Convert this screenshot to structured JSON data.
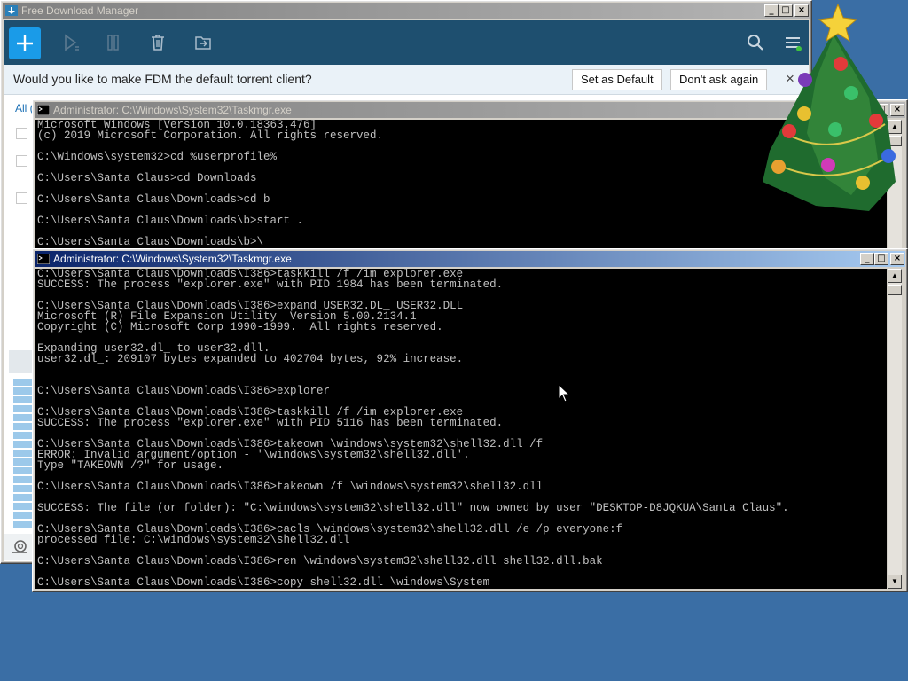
{
  "fdm": {
    "title": "Free Download Manager",
    "banner_text": "Would you like to make FDM the default torrent client?",
    "set_default_label": "Set as Default",
    "dont_ask_label": "Don't ask again",
    "close_glyph": "×",
    "tab_all": "All (",
    "icons": [
      "add-icon",
      "play-icon",
      "pause-icon",
      "trash-icon",
      "move-icon",
      "search-icon",
      "menu-icon"
    ]
  },
  "console1": {
    "title": "Administrator: C:\\Windows\\System32\\Taskmgr.exe",
    "lines": [
      "Microsoft Windows [Version 10.0.18363.476]",
      "(c) 2019 Microsoft Corporation. All rights reserved.",
      "",
      "C:\\Windows\\system32>cd %userprofile%",
      "",
      "C:\\Users\\Santa Claus>cd Downloads",
      "",
      "C:\\Users\\Santa Claus\\Downloads>cd b",
      "",
      "C:\\Users\\Santa Claus\\Downloads\\b>start .",
      "",
      "C:\\Users\\Santa Claus\\Downloads\\b>\\"
    ]
  },
  "console2": {
    "title": "Administrator: C:\\Windows\\System32\\Taskmgr.exe",
    "lines": [
      "C:\\Users\\Santa Claus\\Downloads\\I386>taskkill /f /im explorer.exe",
      "SUCCESS: The process \"explorer.exe\" with PID 1984 has been terminated.",
      "",
      "C:\\Users\\Santa Claus\\Downloads\\I386>expand USER32.DL_ USER32.DLL",
      "Microsoft (R) File Expansion Utility  Version 5.00.2134.1",
      "Copyright (C) Microsoft Corp 1990-1999.  All rights reserved.",
      "",
      "Expanding user32.dl_ to user32.dll.",
      "user32.dl_: 209107 bytes expanded to 402704 bytes, 92% increase.",
      "",
      "",
      "C:\\Users\\Santa Claus\\Downloads\\I386>explorer",
      "",
      "C:\\Users\\Santa Claus\\Downloads\\I386>taskkill /f /im explorer.exe",
      "SUCCESS: The process \"explorer.exe\" with PID 5116 has been terminated.",
      "",
      "C:\\Users\\Santa Claus\\Downloads\\I386>takeown \\windows\\system32\\shell32.dll /f",
      "ERROR: Invalid argument/option - '\\windows\\system32\\shell32.dll'.",
      "Type \"TAKEOWN /?\" for usage.",
      "",
      "C:\\Users\\Santa Claus\\Downloads\\I386>takeown /f \\windows\\system32\\shell32.dll",
      "",
      "SUCCESS: The file (or folder): \"C:\\windows\\system32\\shell32.dll\" now owned by user \"DESKTOP-D8JQKUA\\Santa Claus\".",
      "",
      "C:\\Users\\Santa Claus\\Downloads\\I386>cacls \\windows\\system32\\shell32.dll /e /p everyone:f",
      "processed file: C:\\windows\\system32\\shell32.dll",
      "",
      "C:\\Users\\Santa Claus\\Downloads\\I386>ren \\windows\\system32\\shell32.dll shell32.dll.bak",
      "",
      "C:\\Users\\Santa Claus\\Downloads\\I386>copy shell32.dll \\windows\\System"
    ]
  },
  "window_buttons": {
    "minimize": "_",
    "maximize": "□",
    "close": "×"
  },
  "colors": {
    "desktop": "#3a6ea5",
    "fdm_toolbar": "#1e4f6f",
    "fdm_accent": "#1a9be8"
  }
}
